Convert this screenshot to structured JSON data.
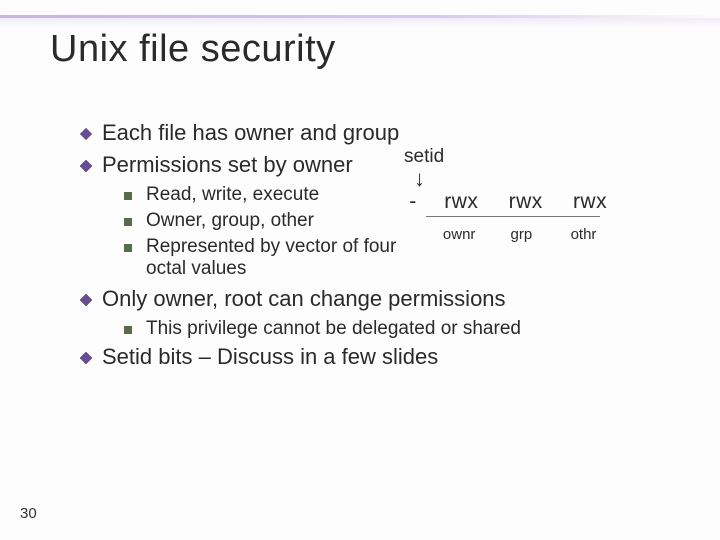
{
  "title": "Unix file security",
  "bullets": {
    "b1": "Each file has owner and group",
    "b2": "Permissions set by owner",
    "b2sub": {
      "s1": "Read, write, execute",
      "s2": "Owner, group, other",
      "s3": "Represented by vector of four octal values"
    },
    "b3": "Only owner, root can change permissions",
    "b3sub": {
      "s1": "This privilege cannot be delegated or shared"
    },
    "b4": "Setid bits – Discuss in a few slides"
  },
  "perm": {
    "setid_label": "setid",
    "dash": "-",
    "triplet": "rwx",
    "owner": "ownr",
    "group": "grp",
    "other": "othr"
  },
  "page_number": "30"
}
